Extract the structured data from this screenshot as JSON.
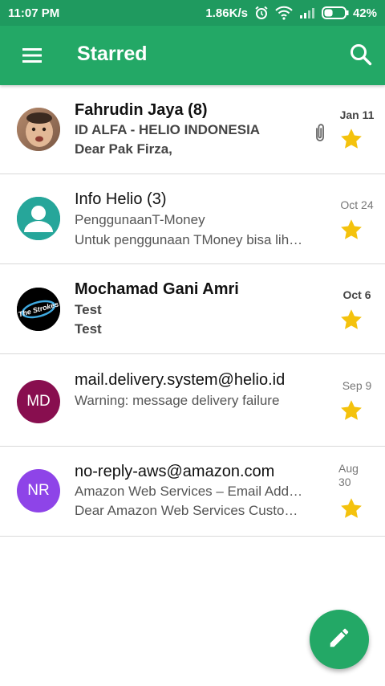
{
  "status_bar": {
    "time": "11:07 PM",
    "network_speed": "1.86K/s",
    "battery_percent": "42%",
    "battery_level": 0.42
  },
  "app_bar": {
    "title": "Starred",
    "menu_icon": "hamburger-menu-icon",
    "search_icon": "search-icon"
  },
  "emails": [
    {
      "sender": "Fahrudin Jaya (8)",
      "subject": "ID ALFA - HELIO INDONESIA",
      "snippet": "Dear Pak Firza,",
      "date": "Jan 11",
      "unread": true,
      "has_attachment": true,
      "starred": true,
      "avatar": {
        "type": "photo"
      }
    },
    {
      "sender": "Info Helio (3)",
      "subject": "PenggunaanT-Money",
      "snippet": "Untuk penggunaan TMoney bisa lih…",
      "date": "Oct 24",
      "unread": false,
      "has_attachment": false,
      "starred": true,
      "avatar": {
        "type": "default-person",
        "color": "#26a69a"
      }
    },
    {
      "sender": "Mochamad Gani Amri",
      "subject": "Test",
      "snippet": "Test",
      "date": "Oct 6",
      "unread": true,
      "has_attachment": false,
      "starred": true,
      "avatar": {
        "type": "logo",
        "logo_text": "The Strokes",
        "color": "#000000"
      }
    },
    {
      "sender": "mail.delivery.system@helio.id",
      "subject": "Warning: message delivery failure",
      "snippet": "",
      "date": "Sep 9",
      "unread": false,
      "has_attachment": false,
      "starred": true,
      "avatar": {
        "type": "initials",
        "initials": "MD",
        "color": "#880e4f"
      }
    },
    {
      "sender": "no-reply-aws@amazon.com",
      "subject": "Amazon Web Services – Email Add…",
      "snippet": "Dear Amazon Web Services Custo…",
      "date": "Aug 30",
      "unread": false,
      "has_attachment": false,
      "starred": true,
      "avatar": {
        "type": "initials",
        "initials": "NR",
        "color": "#8e44e8"
      }
    }
  ],
  "fab": {
    "icon": "pencil-compose-icon"
  },
  "colors": {
    "status_bar": "#1f9a5f",
    "app_bar": "#23a866",
    "star": "#f4c20d",
    "divider": "#d9d9d9"
  }
}
